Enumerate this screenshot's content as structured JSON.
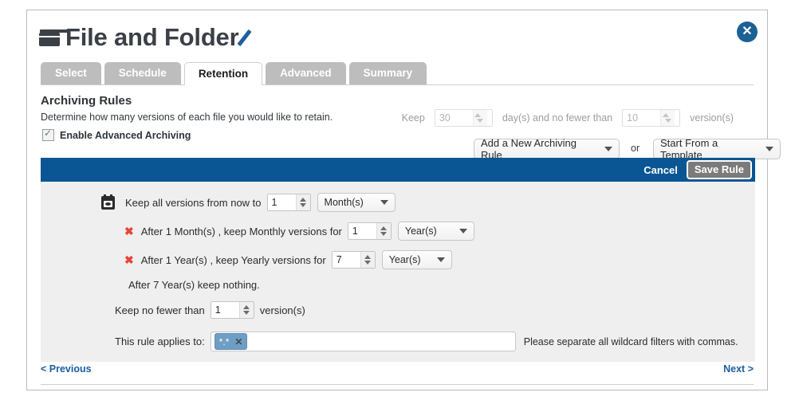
{
  "window": {
    "title": "File and Folder",
    "folder_icon": "folder-icon",
    "edit_icon": "pencil-icon",
    "close_label": "✕"
  },
  "tabs": [
    {
      "label": "Select",
      "active": false
    },
    {
      "label": "Schedule",
      "active": false
    },
    {
      "label": "Retention",
      "active": true
    },
    {
      "label": "Advanced",
      "active": false
    },
    {
      "label": "Summary",
      "active": false
    }
  ],
  "section": {
    "heading": "Archiving Rules",
    "subheading": "Determine how many versions of each file you would like to retain.",
    "enable_label": "Enable Advanced Archiving",
    "enable_checked": true
  },
  "keep_row": {
    "prefix": "Keep",
    "days_value": "30",
    "middle": "day(s) and no fewer than",
    "versions_value": "10",
    "suffix": "version(s)",
    "disabled": true
  },
  "controls": {
    "rule_select": "Add a New Archiving Rule",
    "or_text": "or",
    "template_select": "Start From a Template"
  },
  "rule_bar": {
    "cancel_label": "Cancel",
    "save_label": "Save Rule"
  },
  "rule": {
    "keep_all": {
      "icon": "calendar-icon",
      "prefix": "Keep all versions from now to",
      "value": "1",
      "unit": "Month(s)"
    },
    "monthly": {
      "remove_icon": "✖",
      "prefix": "After 1 Month(s) , keep Monthly versions for",
      "value": "1",
      "unit": "Year(s)"
    },
    "yearly": {
      "remove_icon": "✖",
      "prefix": "After 1 Year(s) , keep Yearly versions for",
      "value": "7",
      "unit": "Year(s)"
    },
    "nothing_text": "After 7 Year(s) keep nothing.",
    "no_fewer": {
      "prefix": "Keep no fewer than",
      "value": "1",
      "suffix": "version(s)"
    },
    "applies_to": {
      "label": "This rule applies to:",
      "tag": "*.*",
      "tag_remove": "✕",
      "hint": "Please separate all wildcard filters with commas."
    }
  },
  "footer": {
    "previous": "< Previous",
    "next": "Next >"
  },
  "colors": {
    "accent_blue": "#0a5694",
    "link_blue": "#1a5fa0",
    "tag_blue": "#6f9ec4",
    "remove_red": "#e8443a",
    "panel_gray": "#efefef"
  }
}
